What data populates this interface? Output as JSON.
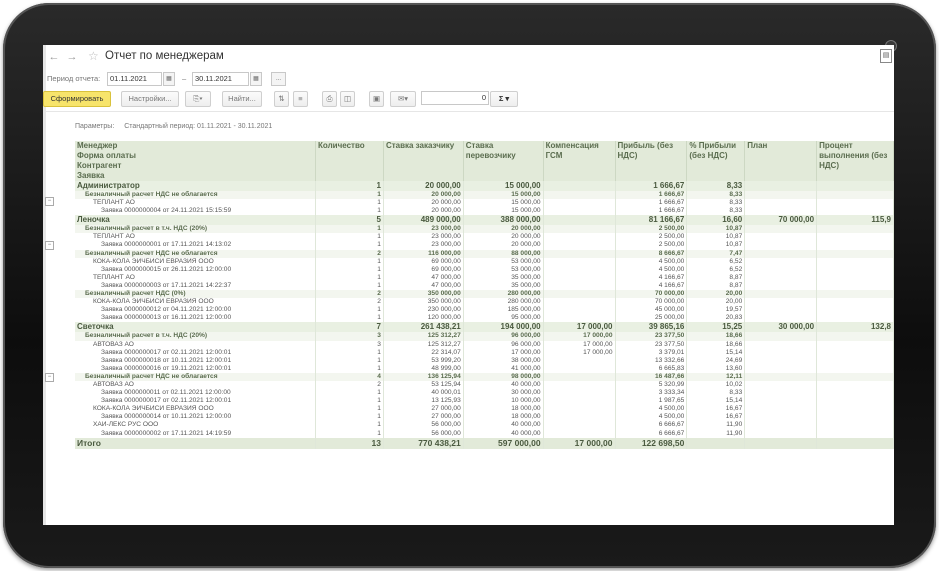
{
  "window": {
    "title": "Отчет по менеджерам"
  },
  "period": {
    "label": "Период отчета:",
    "from": "01.11.2021",
    "to": "30.11.2021",
    "dash": "–",
    "more": "..."
  },
  "toolbar": {
    "generate": "Сформировать",
    "settings": "Настройки...",
    "find": "Найти...",
    "sum_value": "0",
    "sigma": "Σ"
  },
  "params": {
    "label": "Параметры:",
    "value": "Стандартный период: 01.11.2021 - 30.11.2021"
  },
  "headers": {
    "group": [
      "Менеджер",
      "Форма оплаты",
      "Контрагент",
      "Заявка"
    ],
    "qty": "Количество",
    "customer_rate": "Ставка заказчику",
    "carrier_rate": "Ставка перевозчику",
    "fuel": "Компенсация ГСМ",
    "profit": "Прибыль (без НДС)",
    "profit_pct": "% Прибыли (без НДС)",
    "plan": "План",
    "completion": "Процент выполнения (без НДС)"
  },
  "rows": [
    {
      "level": 0,
      "name": "Администратор",
      "qty": "1",
      "cust": "20 000,00",
      "carr": "15 000,00",
      "fuel": "",
      "profit": "1 666,67",
      "pct": "8,33",
      "plan": "",
      "done": ""
    },
    {
      "level": 1,
      "name": "Безналичный расчет НДС не облагается",
      "qty": "1",
      "cust": "20 000,00",
      "carr": "15 000,00",
      "fuel": "",
      "profit": "1 666,67",
      "pct": "8,33",
      "plan": "",
      "done": ""
    },
    {
      "level": 2,
      "name": "ТЕПЛАНТ АО",
      "qty": "1",
      "cust": "20 000,00",
      "carr": "15 000,00",
      "fuel": "",
      "profit": "1 666,67",
      "pct": "8,33",
      "plan": "",
      "done": ""
    },
    {
      "level": 3,
      "name": "Заявка 0000000004 от 24.11.2021 15:15:59",
      "qty": "1",
      "cust": "20 000,00",
      "carr": "15 000,00",
      "fuel": "",
      "profit": "1 666,67",
      "pct": "8,33",
      "plan": "",
      "done": ""
    },
    {
      "level": 0,
      "name": "Леночка",
      "qty": "5",
      "cust": "489 000,00",
      "carr": "388 000,00",
      "fuel": "",
      "profit": "81 166,67",
      "pct": "16,60",
      "plan": "70 000,00",
      "done": "115,9"
    },
    {
      "level": 1,
      "name": "Безналичный расчет в т.ч. НДС (20%)",
      "qty": "1",
      "cust": "23 000,00",
      "carr": "20 000,00",
      "fuel": "",
      "profit": "2 500,00",
      "pct": "10,87",
      "plan": "",
      "done": ""
    },
    {
      "level": 2,
      "name": "ТЕПЛАНТ АО",
      "qty": "1",
      "cust": "23 000,00",
      "carr": "20 000,00",
      "fuel": "",
      "profit": "2 500,00",
      "pct": "10,87",
      "plan": "",
      "done": ""
    },
    {
      "level": 3,
      "name": "Заявка 0000000001 от 17.11.2021 14:13:02",
      "qty": "1",
      "cust": "23 000,00",
      "carr": "20 000,00",
      "fuel": "",
      "profit": "2 500,00",
      "pct": "10,87",
      "plan": "",
      "done": ""
    },
    {
      "level": 1,
      "name": "Безналичный расчет НДС не облагается",
      "qty": "2",
      "cust": "116 000,00",
      "carr": "88 000,00",
      "fuel": "",
      "profit": "8 666,67",
      "pct": "7,47",
      "plan": "",
      "done": ""
    },
    {
      "level": 2,
      "name": "КОКА-КОЛА ЭЙЧБИСИ ЕВРАЗИЯ ООО",
      "qty": "1",
      "cust": "69 000,00",
      "carr": "53 000,00",
      "fuel": "",
      "profit": "4 500,00",
      "pct": "6,52",
      "plan": "",
      "done": ""
    },
    {
      "level": 3,
      "name": "Заявка 0000000015 от 26.11.2021 12:00:00",
      "qty": "1",
      "cust": "69 000,00",
      "carr": "53 000,00",
      "fuel": "",
      "profit": "4 500,00",
      "pct": "6,52",
      "plan": "",
      "done": ""
    },
    {
      "level": 2,
      "name": "ТЕПЛАНТ АО",
      "qty": "1",
      "cust": "47 000,00",
      "carr": "35 000,00",
      "fuel": "",
      "profit": "4 166,67",
      "pct": "8,87",
      "plan": "",
      "done": ""
    },
    {
      "level": 3,
      "name": "Заявка 0000000003 от 17.11.2021 14:22:37",
      "qty": "1",
      "cust": "47 000,00",
      "carr": "35 000,00",
      "fuel": "",
      "profit": "4 166,67",
      "pct": "8,87",
      "plan": "",
      "done": ""
    },
    {
      "level": 1,
      "name": "Безналичный расчет НДС (0%)",
      "qty": "2",
      "cust": "350 000,00",
      "carr": "280 000,00",
      "fuel": "",
      "profit": "70 000,00",
      "pct": "20,00",
      "plan": "",
      "done": ""
    },
    {
      "level": 2,
      "name": "КОКА-КОЛА ЭЙЧБИСИ ЕВРАЗИЯ ООО",
      "qty": "2",
      "cust": "350 000,00",
      "carr": "280 000,00",
      "fuel": "",
      "profit": "70 000,00",
      "pct": "20,00",
      "plan": "",
      "done": ""
    },
    {
      "level": 3,
      "name": "Заявка 0000000012 от 04.11.2021 12:00:00",
      "qty": "1",
      "cust": "230 000,00",
      "carr": "185 000,00",
      "fuel": "",
      "profit": "45 000,00",
      "pct": "19,57",
      "plan": "",
      "done": ""
    },
    {
      "level": 3,
      "name": "Заявка 0000000013 от 16.11.2021 12:00:00",
      "qty": "1",
      "cust": "120 000,00",
      "carr": "95 000,00",
      "fuel": "",
      "profit": "25 000,00",
      "pct": "20,83",
      "plan": "",
      "done": ""
    },
    {
      "level": 0,
      "name": "Светочка",
      "qty": "7",
      "cust": "261 438,21",
      "carr": "194 000,00",
      "fuel": "17 000,00",
      "profit": "39 865,16",
      "pct": "15,25",
      "plan": "30 000,00",
      "done": "132,8"
    },
    {
      "level": 1,
      "name": "Безналичный расчет в т.ч. НДС (20%)",
      "qty": "3",
      "cust": "125 312,27",
      "carr": "96 000,00",
      "fuel": "17 000,00",
      "profit": "23 377,50",
      "pct": "18,66",
      "plan": "",
      "done": ""
    },
    {
      "level": 2,
      "name": "АВТОВАЗ АО",
      "qty": "3",
      "cust": "125 312,27",
      "carr": "96 000,00",
      "fuel": "17 000,00",
      "profit": "23 377,50",
      "pct": "18,66",
      "plan": "",
      "done": ""
    },
    {
      "level": 3,
      "name": "Заявка 0000000017 от 02.11.2021 12:00:01",
      "qty": "1",
      "cust": "22 314,07",
      "carr": "17 000,00",
      "fuel": "17 000,00",
      "profit": "3 379,01",
      "pct": "15,14",
      "plan": "",
      "done": ""
    },
    {
      "level": 3,
      "name": "Заявка 0000000018 от 10.11.2021 12:00:01",
      "qty": "1",
      "cust": "53 999,20",
      "carr": "38 000,00",
      "fuel": "",
      "profit": "13 332,66",
      "pct": "24,69",
      "plan": "",
      "done": ""
    },
    {
      "level": 3,
      "name": "Заявка 0000000016 от 19.11.2021 12:00:01",
      "qty": "1",
      "cust": "48 999,00",
      "carr": "41 000,00",
      "fuel": "",
      "profit": "6 665,83",
      "pct": "13,60",
      "plan": "",
      "done": ""
    },
    {
      "level": 1,
      "name": "Безналичный расчет НДС не облагается",
      "qty": "4",
      "cust": "136 125,94",
      "carr": "98 000,00",
      "fuel": "",
      "profit": "16 487,66",
      "pct": "12,11",
      "plan": "",
      "done": ""
    },
    {
      "level": 2,
      "name": "АВТОВАЗ АО",
      "qty": "2",
      "cust": "53 125,94",
      "carr": "40 000,00",
      "fuel": "",
      "profit": "5 320,99",
      "pct": "10,02",
      "plan": "",
      "done": ""
    },
    {
      "level": 3,
      "name": "Заявка 0000000011 от 02.11.2021 12:00:00",
      "qty": "1",
      "cust": "40 000,01",
      "carr": "30 000,00",
      "fuel": "",
      "profit": "3 333,34",
      "pct": "8,33",
      "plan": "",
      "done": ""
    },
    {
      "level": 3,
      "name": "Заявка 0000000017 от 02.11.2021 12:00:01",
      "qty": "1",
      "cust": "13 125,93",
      "carr": "10 000,00",
      "fuel": "",
      "profit": "1 987,65",
      "pct": "15,14",
      "plan": "",
      "done": ""
    },
    {
      "level": 2,
      "name": "КОКА-КОЛА ЭЙЧБИСИ ЕВРАЗИЯ ООО",
      "qty": "1",
      "cust": "27 000,00",
      "carr": "18 000,00",
      "fuel": "",
      "profit": "4 500,00",
      "pct": "16,67",
      "plan": "",
      "done": ""
    },
    {
      "level": 3,
      "name": "Заявка 0000000014 от 10.11.2021 12:00:00",
      "qty": "1",
      "cust": "27 000,00",
      "carr": "18 000,00",
      "fuel": "",
      "profit": "4 500,00",
      "pct": "16,67",
      "plan": "",
      "done": ""
    },
    {
      "level": 2,
      "name": "ХАЙ-ЛЕКС РУС ООО",
      "qty": "1",
      "cust": "56 000,00",
      "carr": "40 000,00",
      "fuel": "",
      "profit": "6 666,67",
      "pct": "11,90",
      "plan": "",
      "done": ""
    },
    {
      "level": 3,
      "name": "Заявка 0000000002 от 17.11.2021 14:19:59",
      "qty": "1",
      "cust": "56 000,00",
      "carr": "40 000,00",
      "fuel": "",
      "profit": "6 666,67",
      "pct": "11,90",
      "plan": "",
      "done": ""
    }
  ],
  "total": {
    "name": "Итого",
    "qty": "13",
    "cust": "770 438,21",
    "carr": "597 000,00",
    "fuel": "17 000,00",
    "profit": "122 698,50",
    "pct": "",
    "plan": "",
    "done": ""
  },
  "colors": {
    "accent": "#f7e46b",
    "header_bg": "#e2ead9",
    "bezel": "#111111"
  }
}
